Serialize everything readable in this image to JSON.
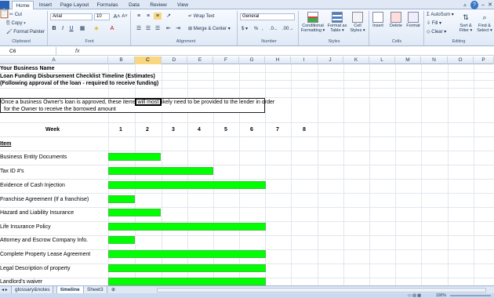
{
  "ribbon_tabs": [
    "Home",
    "Insert",
    "Page Layout",
    "Formulas",
    "Data",
    "Review",
    "View"
  ],
  "active_tab": "Home",
  "clipboard": {
    "cut": "Cut",
    "copy": "Copy ▾",
    "format_painter": "Format Painter",
    "label": "Clipboard"
  },
  "font": {
    "name": "Arial",
    "size": "10",
    "bold": "B",
    "italic": "I",
    "underline": "U",
    "label": "Font"
  },
  "alignment": {
    "wrap_text": "Wrap Text",
    "merge_center": "Merge & Center ▾",
    "label": "Alignment"
  },
  "number": {
    "format": "General",
    "currency": "$ ▾",
    "percent": "%",
    "comma": ",",
    "label": "Number"
  },
  "styles": {
    "conditional": "Conditional Formatting ▾",
    "format_table": "Format as Table ▾",
    "cell_styles": "Cell Styles ▾",
    "label": "Styles"
  },
  "cells": {
    "insert": "Insert",
    "delete": "Delete",
    "format": "Format",
    "label": "Cells"
  },
  "editing": {
    "autosum": "AutoSum ▾",
    "fill": "Fill ▾",
    "clear": "Clear ▾",
    "sort_filter": "Sort & Filter ▾",
    "find_select": "Find & Select ▾",
    "label": "Editing"
  },
  "formula_bar": {
    "cell_ref": "C6",
    "fx": "fx",
    "content": ""
  },
  "columns": [
    "A",
    "B",
    "C",
    "D",
    "E",
    "F",
    "G",
    "H",
    "I",
    "J",
    "K",
    "L",
    "M",
    "N",
    "O",
    "P"
  ],
  "selected_column": "C",
  "sheet": {
    "title1": "Your Business Name",
    "title2": "Loan Funding Disbursement Checklist Timeline (Estimates)",
    "title3": "(Following approval of the loan - required to receive funding)",
    "note_line1": "Once a business Owner's loan is approved, these items will most likely need to be provided to the lender in order",
    "note_line2": "for the Owner to receive the borrowed amount",
    "week_label": "Week",
    "weeks": [
      "1",
      "2",
      "3",
      "4",
      "5",
      "6",
      "7",
      "8"
    ],
    "item_header": "Item",
    "items": [
      {
        "label": "Business Entity Documents",
        "weeks": 2
      },
      {
        "label": "Tax ID #'s",
        "weeks": 4
      },
      {
        "label": "Evidence of Cash Injection",
        "weeks": 6
      },
      {
        "label": "Franchise Agreement (If a franchise)",
        "weeks": 1
      },
      {
        "label": "Hazard and Liability Insurance",
        "weeks": 2
      },
      {
        "label": "Life Insurance Policy",
        "weeks": 6
      },
      {
        "label": "Attorney and Escrow Company Info.",
        "weeks": 1
      },
      {
        "label": "Complete Property Lease Agreement",
        "weeks": 6
      },
      {
        "label": "Legal Description of property",
        "weeks": 6
      },
      {
        "label": "Landlord's waiver",
        "weeks": 6
      }
    ]
  },
  "sheet_tabs": [
    "glossary&notes",
    "timeline",
    "Sheet3"
  ],
  "active_sheet": "timeline",
  "zoom": "100%",
  "colors": {
    "bar": "#00ff00",
    "ribbon_bg": "#dfe9f6",
    "selected_header": "#f8d780"
  }
}
